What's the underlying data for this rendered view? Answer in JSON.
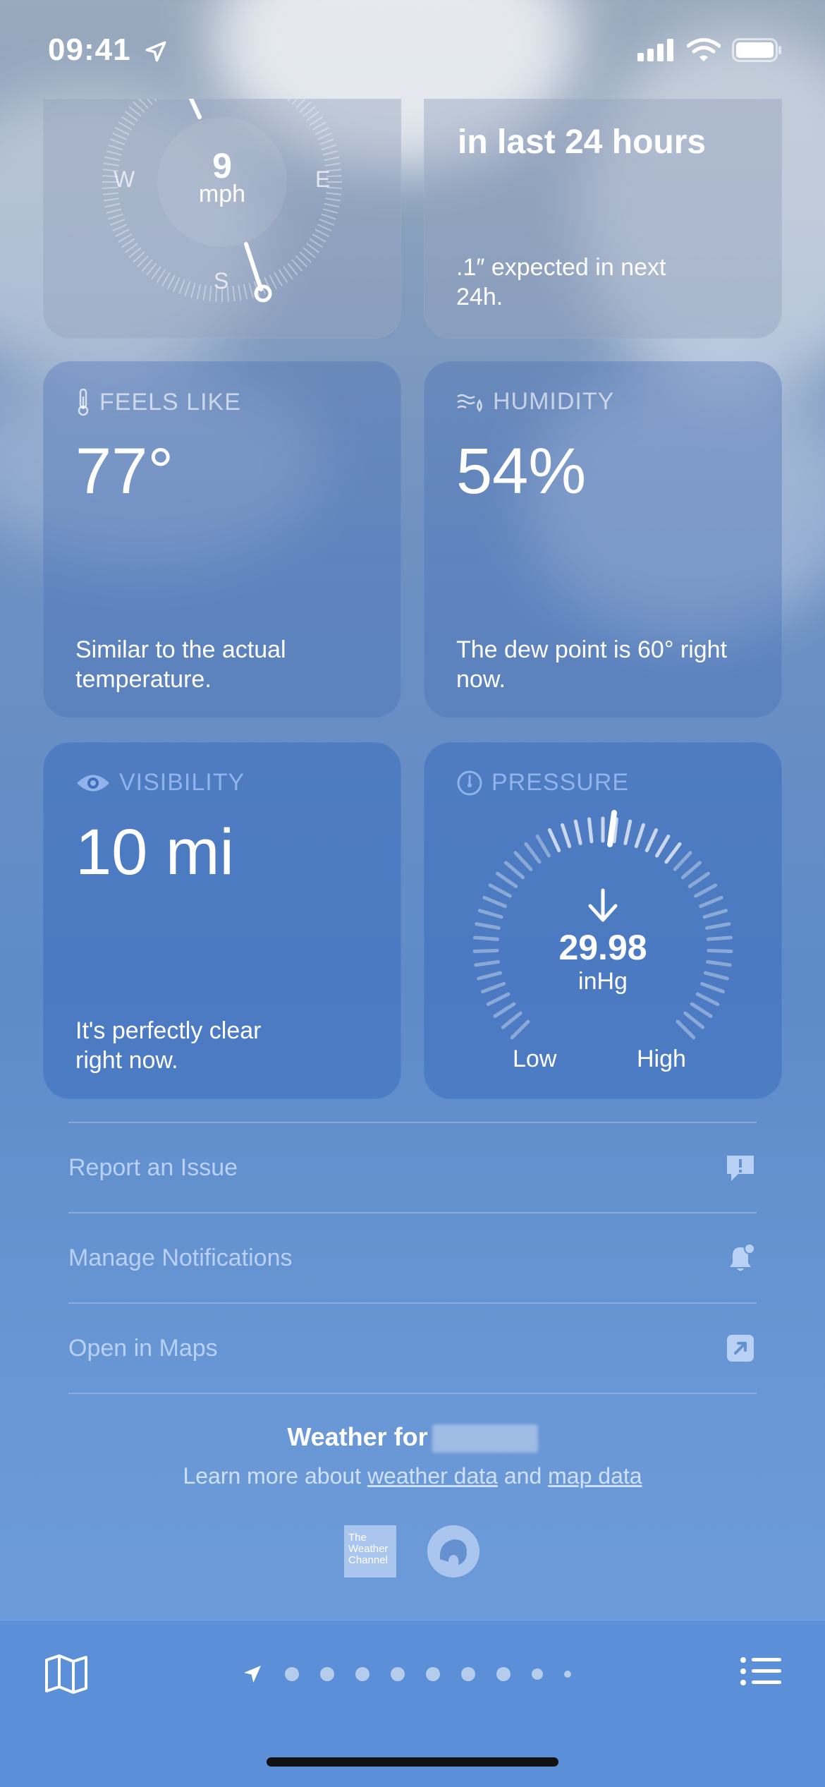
{
  "status_bar": {
    "time": "09:41"
  },
  "wind": {
    "speed": "9",
    "unit": "mph",
    "dir_w": "W",
    "dir_e": "E",
    "dir_s": "S"
  },
  "precip": {
    "heading": "in last 24 hours",
    "desc": ".1″ expected in next 24h."
  },
  "feels_like": {
    "title": "FEELS LIKE",
    "value": "77°",
    "desc": "Similar to the actual temperature."
  },
  "humidity": {
    "title": "HUMIDITY",
    "value": "54%",
    "desc": "The dew point is 60° right now."
  },
  "visibility": {
    "title": "VISIBILITY",
    "value": "10 mi",
    "desc": "It's perfectly clear right now."
  },
  "pressure": {
    "title": "PRESSURE",
    "value": "29.98",
    "unit": "inHg",
    "low": "Low",
    "high": "High"
  },
  "links": [
    {
      "label": "Report an Issue",
      "icon": "report-bubble-icon"
    },
    {
      "label": "Manage Notifications",
      "icon": "bell-badge-icon"
    },
    {
      "label": "Open in Maps",
      "icon": "arrow-up-right-square-icon"
    }
  ],
  "footer": {
    "title": "Weather for",
    "learn_prefix": "Learn more about",
    "weather_data": "weather data",
    "and": "and",
    "map_data": "map data",
    "twc": "The Weather Channel"
  },
  "colors": {
    "tab_bar": "#5b8fd8",
    "link_text": "#b8d1f5",
    "accent_title": "#8fb3ea"
  }
}
